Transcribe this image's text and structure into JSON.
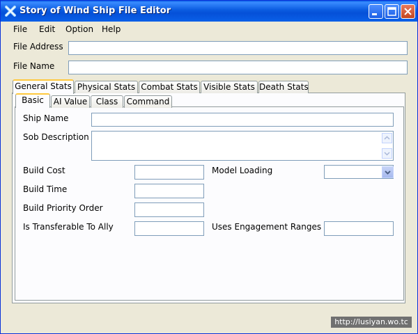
{
  "window": {
    "title": "Story of Wind Ship File Editor"
  },
  "menu": [
    "File",
    "Edit",
    "Option",
    "Help"
  ],
  "fields": {
    "file_address_label": "File Address",
    "file_address_value": "",
    "file_name_label": "File Name",
    "file_name_value": ""
  },
  "outer_tabs": [
    "General Stats",
    "Physical Stats",
    "Combat Stats",
    "Visible Stats",
    "Death Stats"
  ],
  "inner_tabs": [
    "Basic",
    "AI Value",
    "Class",
    "Command"
  ],
  "basic": {
    "ship_name_label": "Ship Name",
    "sob_description_label": "Sob Description",
    "build_cost_label": "Build Cost",
    "build_time_label": "Build Time",
    "build_priority_order_label": "Build Priority Order",
    "is_transferable_label": "Is Transferable To Ally",
    "model_loading_label": "Model Loading",
    "uses_engagement_ranges_label": "Uses Engagement Ranges"
  },
  "status": {
    "url": "http://lusiyan.wo.tc"
  },
  "colors": {
    "titlebar": "#0a5be0",
    "active_tab_accent": "#ffc83c",
    "face": "#ece9d8"
  }
}
